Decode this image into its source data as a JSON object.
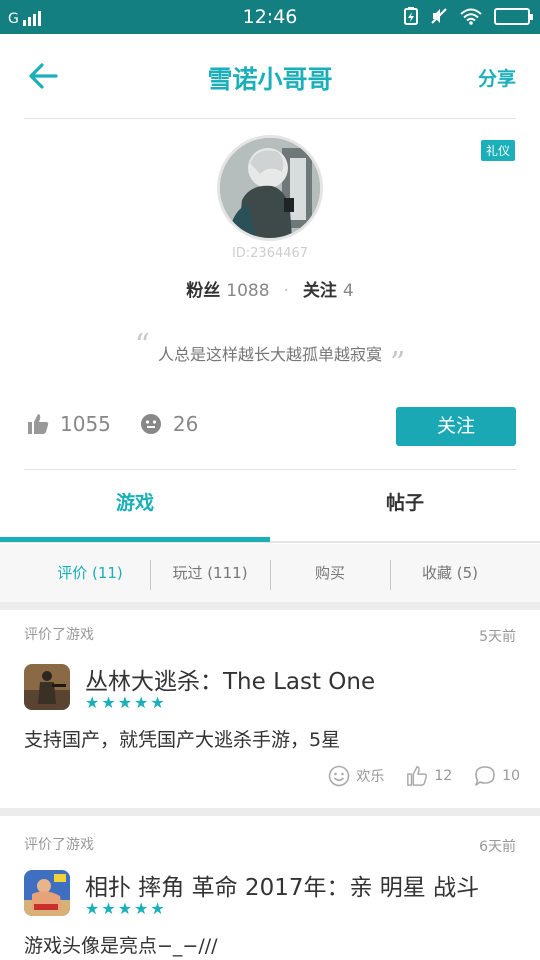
{
  "status_bar": {
    "carrier": "G",
    "time": "12:46"
  },
  "header": {
    "title": "雪诺小哥哥",
    "share": "分享"
  },
  "profile": {
    "badge": "礼仪",
    "user_id": "ID:2364467",
    "fans_label": "粉丝",
    "fans_count": "1088",
    "following_label": "关注",
    "following_count": "4",
    "bio": "人总是这样越长大越孤单越寂寞",
    "likes": "1055",
    "faces": "26",
    "follow_button": "关注"
  },
  "tabs": [
    {
      "label": "游戏",
      "active": true
    },
    {
      "label": "帖子",
      "active": false
    }
  ],
  "subtabs": [
    {
      "label": "评价 (11)",
      "active": true
    },
    {
      "label": "玩过 (111)",
      "active": false
    },
    {
      "label": "购买",
      "active": false
    },
    {
      "label": "收藏 (5)",
      "active": false
    }
  ],
  "reviews": [
    {
      "meta": "评价了游戏",
      "time": "5天前",
      "game": "丛林大逃杀：The Last One",
      "stars": "★★★★★",
      "text": "支持国产，就凭国产大逃杀手游，5星",
      "reaction": "欢乐",
      "likes": "12",
      "comments": "10"
    },
    {
      "meta": "评价了游戏",
      "time": "6天前",
      "game": "相扑 摔角 革命 2017年：亲 明星 战斗",
      "stars": "★★★★★",
      "text": "游戏头像是亮点−_−///"
    }
  ],
  "colors": {
    "status_bar": "#137f80",
    "accent": "#1aafb9"
  }
}
